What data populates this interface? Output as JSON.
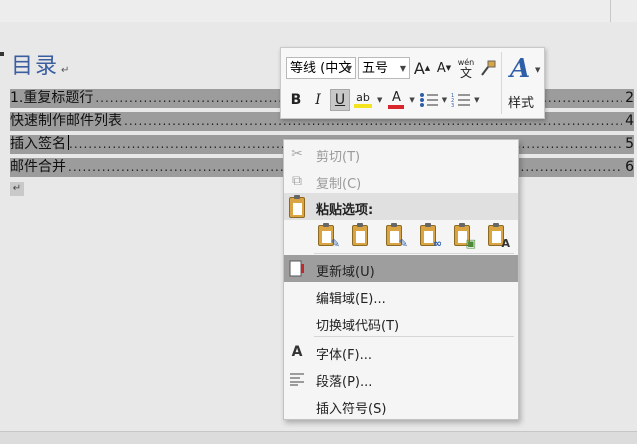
{
  "document": {
    "toc_title": "目录",
    "paragraph_mark": "↵",
    "entries": [
      {
        "text": "1.重复标题行",
        "dots": "......................................................................................................................................................................................................",
        "page": "2"
      },
      {
        "text": "快速制作邮件列表",
        "dots": "..................................................................................................................................................................................................",
        "page": "4"
      },
      {
        "text": "插入签名",
        "dots": "........................................................................................................................................................................................................",
        "page": "5"
      },
      {
        "text": "邮件合并",
        "dots": "........................................................................................................................................................................................................",
        "page": "6"
      }
    ]
  },
  "mini_toolbar": {
    "font_name": "等线 (中文",
    "font_size": "五号",
    "grow_font": "A",
    "shrink_font": "A",
    "phonetic": "wén",
    "phonetic_char": "文",
    "bold": "B",
    "italic": "I",
    "underline": "U",
    "highlight": "ab",
    "font_color": "A",
    "styles_label": "样式",
    "colors": {
      "highlight": "#f4e31f",
      "font_color": "#d9262a",
      "styles": "#2f5ea8"
    }
  },
  "context_menu": {
    "items": [
      {
        "label": "剪切(T)",
        "icon": "scissors-icon",
        "disabled": true
      },
      {
        "label": "复制(C)",
        "icon": "copy-icon",
        "disabled": true
      },
      {
        "label": "粘贴选项:",
        "icon": "paste-icon",
        "header": true
      },
      {
        "label": "更新域(U)",
        "icon": "update-field-icon",
        "hot": true
      },
      {
        "label": "编辑域(E)...",
        "icon": ""
      },
      {
        "label": "切换域代码(T)",
        "icon": ""
      },
      {
        "label": "字体(F)...",
        "icon": "font-icon"
      },
      {
        "label": "段落(P)...",
        "icon": "paragraph-icon"
      },
      {
        "label": "插入符号(S)",
        "icon": ""
      }
    ]
  }
}
